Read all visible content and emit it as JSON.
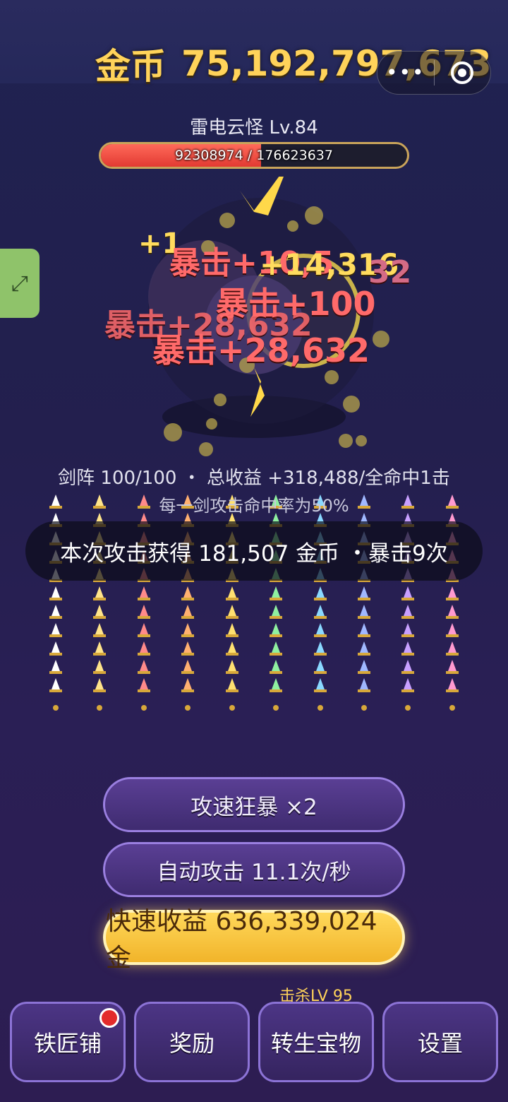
{
  "header": {
    "coin_label": "金币",
    "coin_value": "75,192,797,673",
    "capsule_more": "•••"
  },
  "boss": {
    "name": "雷电云怪 Lv.84",
    "hp_text": "92308974 / 176623637",
    "hp_current": 92308974,
    "hp_max": 176623637
  },
  "damage_popups": [
    "+1",
    "暴击+10,5",
    "+14,316",
    "32",
    "暴击+100",
    "暴击+28,632",
    "暴击+28,632"
  ],
  "stats": {
    "array_info": "剑阵 100/100 ・ 总收益 +318,488/全命中1击",
    "hit_rate": "每一剑攻击命中率为50%",
    "reward": "本次攻击获得 181,507 金币 ・暴击9次"
  },
  "buttons": {
    "frenzy": "攻速狂暴 ×2",
    "auto_attack": "自动攻击 11.1次/秒",
    "quick_income": "快速收益 636,339,024金"
  },
  "nav": {
    "kill_label": "击杀LV 95",
    "items": [
      "铁匠铺",
      "奖励",
      "转生宝物",
      "设置"
    ]
  },
  "colors": {
    "gold_text": "#ffd35a",
    "hp_fill": "#e23a32",
    "button_purple": "#3f2b70",
    "button_gold": "#f1b42a"
  }
}
